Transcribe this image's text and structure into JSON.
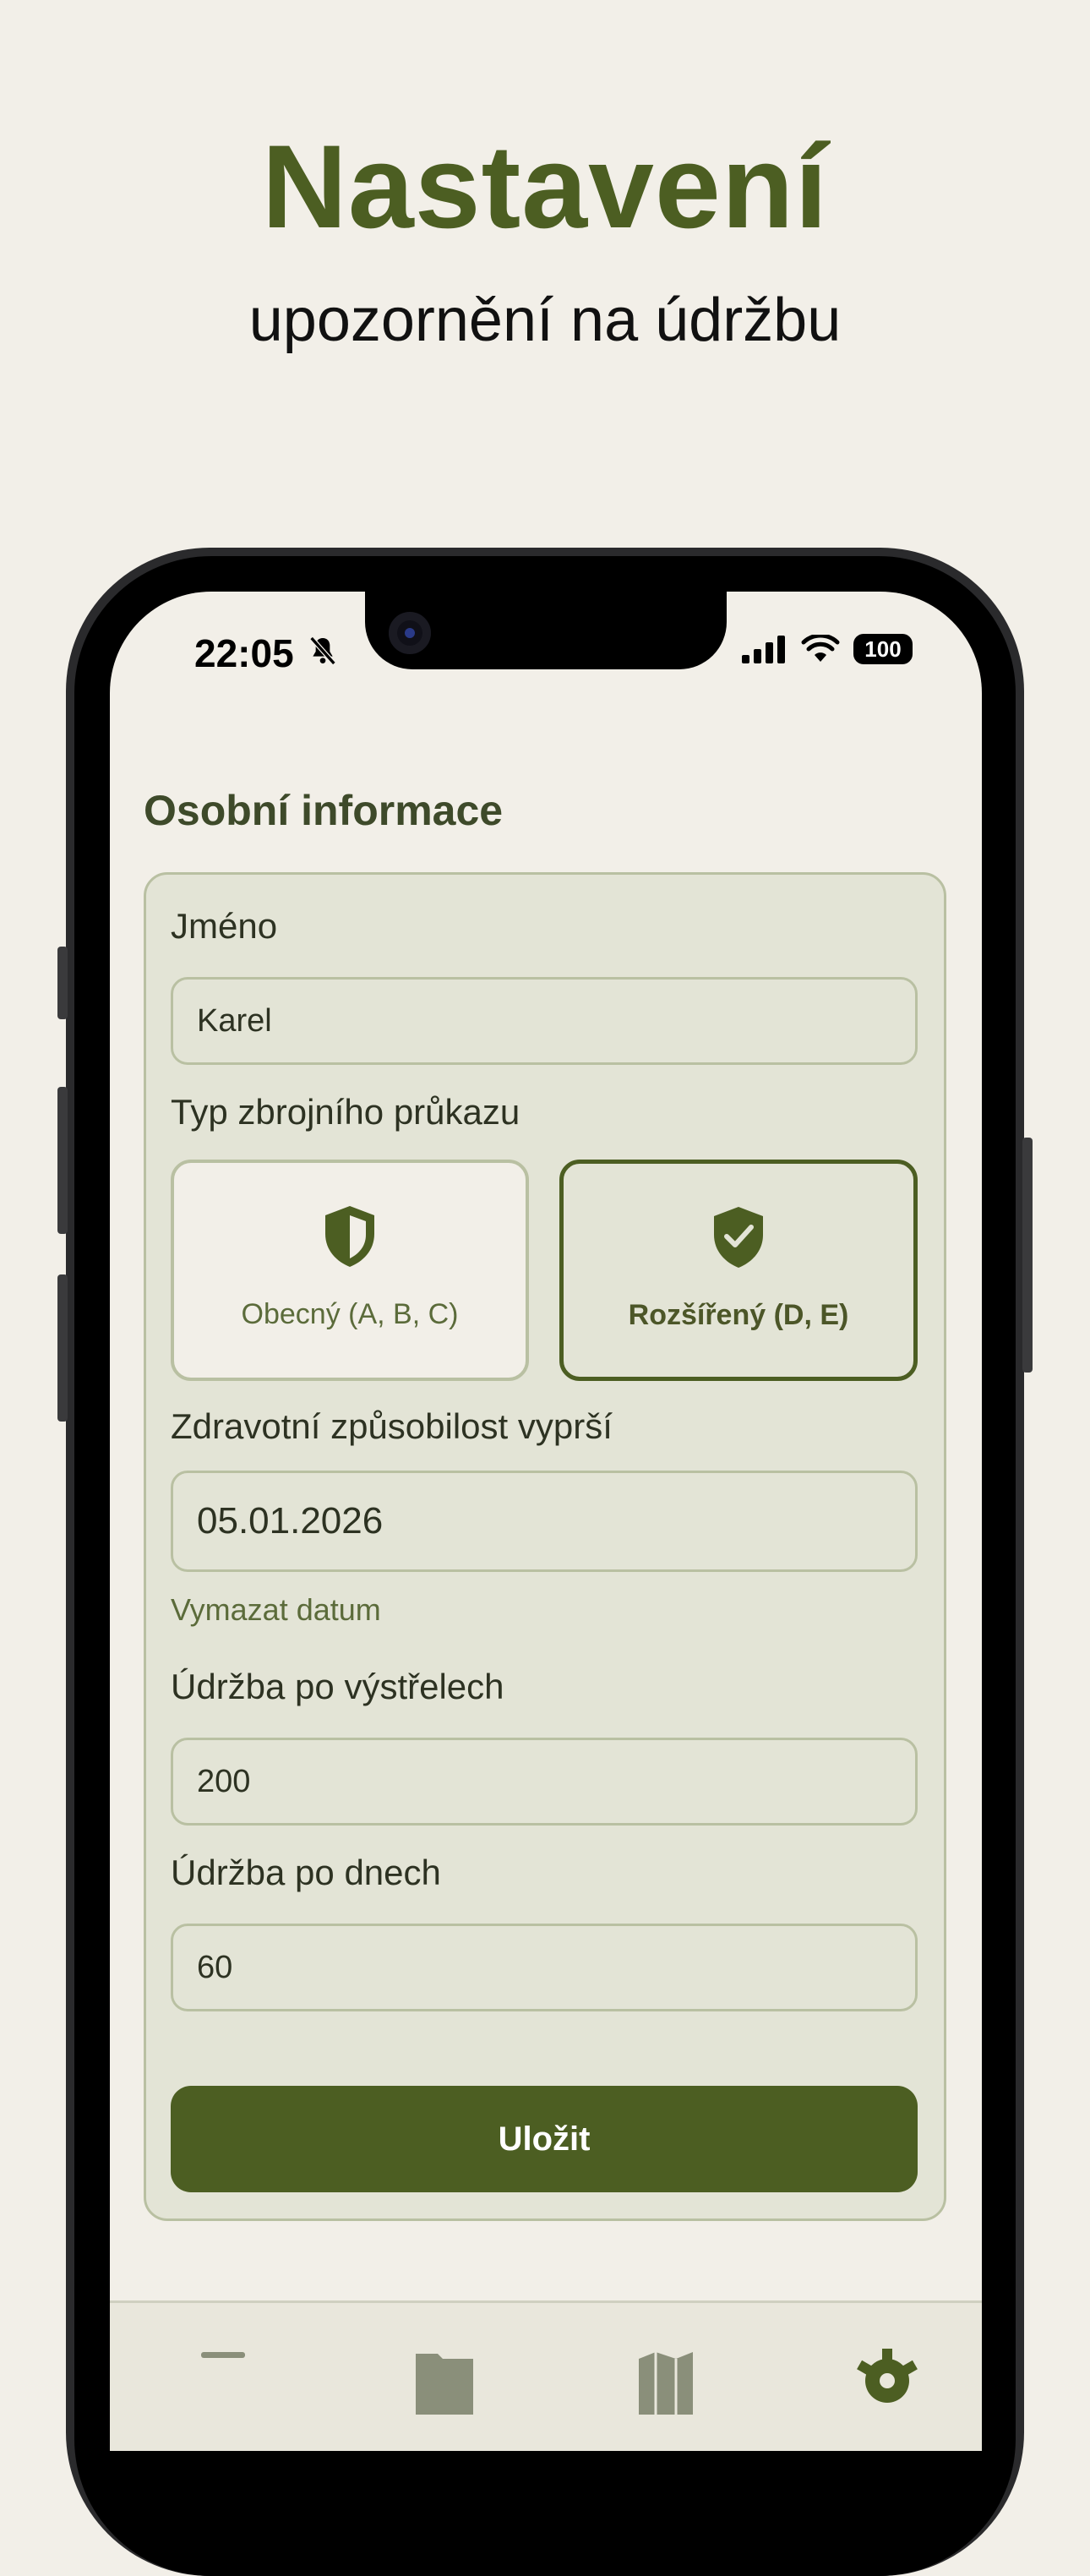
{
  "hero": {
    "title": "Nastavení",
    "subtitle": "upozornění na údržbu"
  },
  "status_bar": {
    "time": "22:05",
    "battery": "100",
    "icons": [
      "bell-slash-icon",
      "signal-icon",
      "wifi-icon",
      "battery-icon"
    ]
  },
  "section": {
    "title": "Osobní informace"
  },
  "form": {
    "name_label": "Jméno",
    "name_value": "Karel",
    "license_label": "Typ zbrojního průkazu",
    "license_options": [
      {
        "label": "Obecný (A, B, C)",
        "icon": "shield-half-icon",
        "selected": false
      },
      {
        "label": "Rozšířený (D, E)",
        "icon": "shield-check-icon",
        "selected": true
      }
    ],
    "health_label": "Zdravotní způsobilost vyprší",
    "health_value": "05.01.2026",
    "clear_date_link": "Vymazat datum",
    "shots_label": "Údržba po výstřelech",
    "shots_value": "200",
    "days_label": "Údržba po dnech",
    "days_value": "60",
    "save_label": "Uložit"
  },
  "tabbar": {
    "icons": [
      "list-icon",
      "folder-icon",
      "map-icon",
      "gear-icon"
    ]
  },
  "colors": {
    "accent": "#4c5e22",
    "background": "#f2efe8",
    "card": "#e3e4d6",
    "border": "#b9c0a2"
  }
}
